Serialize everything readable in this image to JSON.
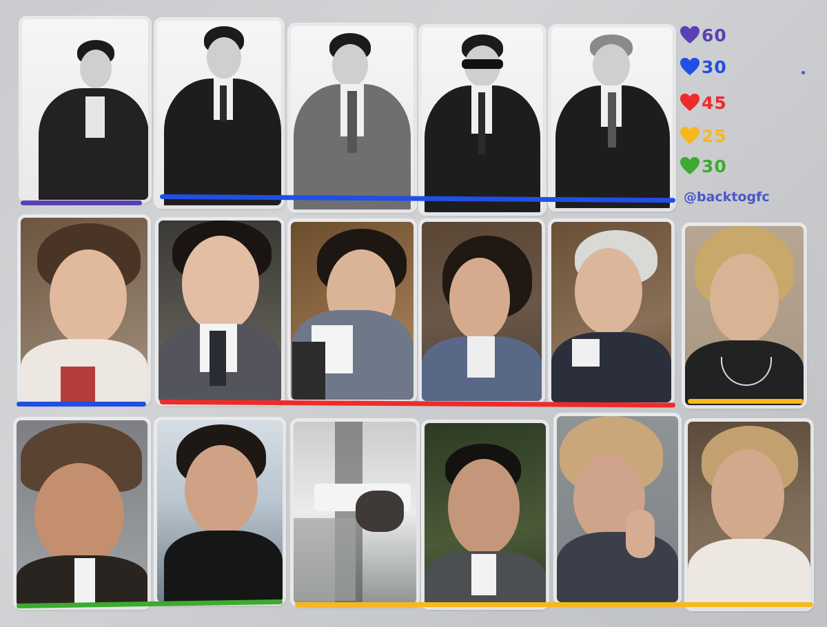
{
  "prices": [
    {
      "color": "#5b3fb4",
      "label": "60"
    },
    {
      "color": "#1f4fe6",
      "label": "30"
    },
    {
      "color": "#ee2b2b",
      "label": "45"
    },
    {
      "color": "#f7b81e",
      "label": "25"
    },
    {
      "color": "#3cab2f",
      "label": "30"
    }
  ],
  "handle": "@backtogfc",
  "colors": {
    "purple": "#5b3fb4",
    "blue": "#1f4fe6",
    "red": "#ee2b2b",
    "yellow": "#f7b81e",
    "green": "#3cab2f",
    "background": "#cbcdd0"
  },
  "photocards": {
    "row1": [
      "bw-suit-portrait",
      "bw-suit-portrait",
      "bw-grey-suit-portrait",
      "bw-sunglasses-portrait",
      "bw-suit-portrait"
    ],
    "row2": [
      "color-selfie",
      "color-suit-selfie",
      "color-suit-selfie",
      "color-suit-selfie",
      "color-suit-selfie",
      "color-selfie"
    ],
    "row3": [
      "color-cap-portrait",
      "color-outdoor-portrait",
      "color-reflection-photo",
      "color-green-portrait",
      "color-curly-portrait",
      "color-selfie"
    ]
  }
}
